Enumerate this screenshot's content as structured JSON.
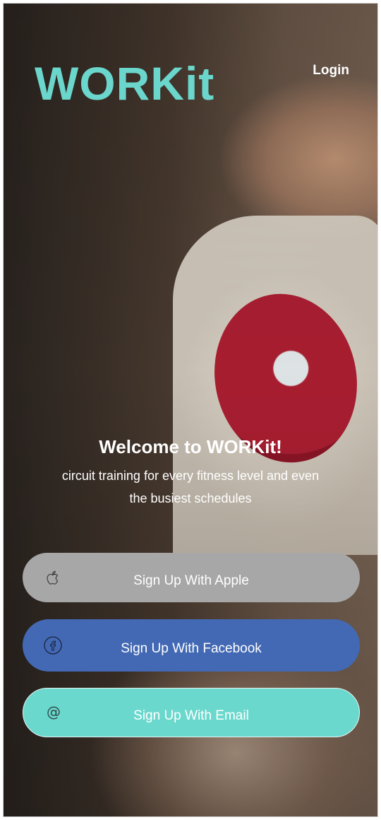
{
  "header": {
    "logo": "WORKit",
    "login_label": "Login"
  },
  "hero": {
    "welcome": "Welcome to WORKit!",
    "tagline": "circuit training for every fitness level and even the busiest schedules"
  },
  "buttons": {
    "apple": {
      "label": "Sign Up With Apple",
      "icon": "apple-icon"
    },
    "facebook": {
      "label": "Sign Up With Facebook",
      "icon": "facebook-icon"
    },
    "email": {
      "label": "Sign Up With Email",
      "icon": "at-icon"
    }
  },
  "colors": {
    "brand": "#6bd6cc",
    "apple": "#a7a7a7",
    "facebook": "#4369b4",
    "email": "#6bd8cd"
  }
}
